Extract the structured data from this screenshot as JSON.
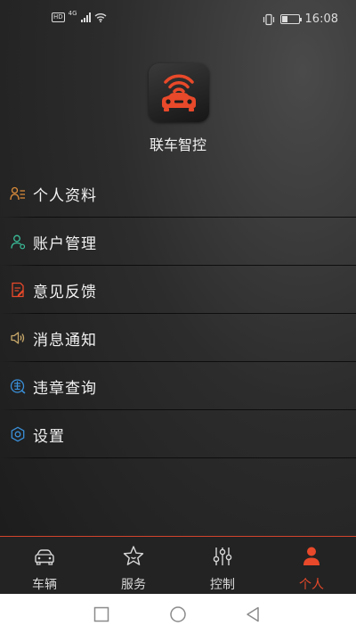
{
  "status_bar": {
    "hd_badge": "HD",
    "network_type": "4G",
    "battery_level": 0.35,
    "time": "16:08"
  },
  "app": {
    "name": "联车智控",
    "logo": "car-signal-icon",
    "accent_color": "#e8492a"
  },
  "menu": {
    "items": [
      {
        "label": "个人资料",
        "icon": "profile-list-icon",
        "icon_color": "#d88a3a"
      },
      {
        "label": "账户管理",
        "icon": "account-user-icon",
        "icon_color": "#3bbf9a"
      },
      {
        "label": "意见反馈",
        "icon": "feedback-edit-icon",
        "icon_color": "#e8492a"
      },
      {
        "label": "消息通知",
        "icon": "speaker-icon",
        "icon_color": "#c9a96a"
      },
      {
        "label": "违章查询",
        "icon": "violation-query-icon",
        "icon_color": "#3a8fd8"
      },
      {
        "label": "设置",
        "icon": "settings-gear-icon",
        "icon_color": "#3a8fd8"
      }
    ]
  },
  "tab_bar": {
    "tabs": [
      {
        "label": "车辆",
        "icon": "car-icon",
        "active": false
      },
      {
        "label": "服务",
        "icon": "star-smile-icon",
        "active": false
      },
      {
        "label": "控制",
        "icon": "sliders-icon",
        "active": false
      },
      {
        "label": "个人",
        "icon": "person-icon",
        "active": true
      }
    ]
  },
  "system_nav": {
    "buttons": [
      "recent-apps-icon",
      "home-icon",
      "back-icon"
    ]
  }
}
